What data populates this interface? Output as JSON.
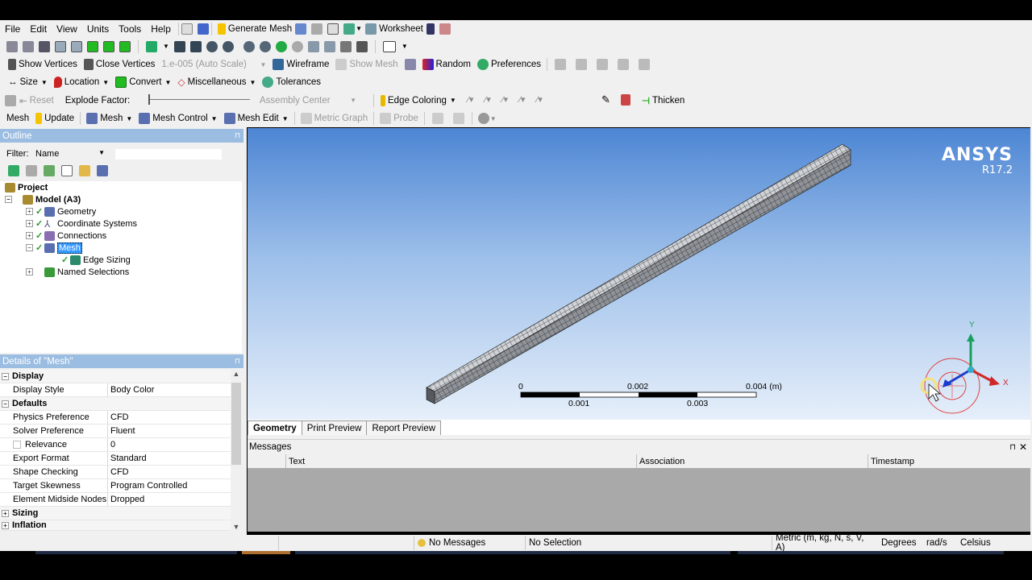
{
  "menu": [
    "File",
    "Edit",
    "View",
    "Units",
    "Tools",
    "Help"
  ],
  "menubar_tools": {
    "generate_mesh": "Generate Mesh",
    "worksheet": "Worksheet"
  },
  "row3": {
    "show_vertices": "Show Vertices",
    "close_vertices": "Close Vertices",
    "scale": "1.e-005 (Auto Scale)",
    "wireframe": "Wireframe",
    "show_mesh": "Show Mesh",
    "random": "Random",
    "preferences": "Preferences"
  },
  "row4": {
    "size": "Size",
    "location": "Location",
    "convert": "Convert",
    "miscellaneous": "Miscellaneous",
    "tolerances": "Tolerances"
  },
  "row5": {
    "reset": "Reset",
    "explode_factor": "Explode Factor:",
    "assembly_center": "Assembly Center",
    "edge_coloring": "Edge Coloring",
    "thicken": "Thicken"
  },
  "row6": {
    "mesh_label": "Mesh",
    "update": "Update",
    "mesh": "Mesh",
    "mesh_control": "Mesh Control",
    "mesh_edit": "Mesh Edit",
    "metric_graph": "Metric Graph",
    "probe": "Probe"
  },
  "outline": {
    "title": "Outline",
    "filter_label": "Filter:",
    "filter_value": "Name",
    "tree": {
      "project": "Project",
      "model": "Model (A3)",
      "geometry": "Geometry",
      "coordinate_systems": "Coordinate Systems",
      "connections": "Connections",
      "mesh": "Mesh",
      "edge_sizing": "Edge Sizing",
      "named_selections": "Named Selections"
    }
  },
  "details": {
    "title": "Details of \"Mesh\"",
    "sections": {
      "display": "Display",
      "defaults": "Defaults",
      "sizing": "Sizing",
      "inflation": "Inflation"
    },
    "rows": [
      {
        "k": "Display Style",
        "v": "Body Color"
      },
      {
        "k": "Physics Preference",
        "v": "CFD"
      },
      {
        "k": "Solver Preference",
        "v": "Fluent"
      },
      {
        "k": "Relevance",
        "v": "0"
      },
      {
        "k": "Export Format",
        "v": "Standard"
      },
      {
        "k": "Shape Checking",
        "v": "CFD"
      },
      {
        "k": "Target Skewness",
        "v": "Program Controlled"
      },
      {
        "k": "Element Midside Nodes",
        "v": "Dropped"
      }
    ]
  },
  "viewport": {
    "brand": "ANSYS",
    "version": "R17.2",
    "scale_top": [
      "0",
      "0.002",
      "0.004 (m)"
    ],
    "scale_bottom": [
      "0.001",
      "0.003"
    ],
    "axis_x": "X",
    "axis_y": "Y"
  },
  "tabs": [
    "Geometry",
    "Print Preview",
    "Report Preview"
  ],
  "messages": {
    "title": "Messages",
    "columns": [
      "Text",
      "Association",
      "Timestamp"
    ]
  },
  "status": {
    "no_messages": "No Messages",
    "no_selection": "No Selection",
    "units": "Metric (m, kg, N, s, V, A)",
    "degrees": "Degrees",
    "rads": "rad/s",
    "celsius": "Celsius"
  },
  "colors": {
    "panel_title": "#9bbde2",
    "viewport_top": "#4d86d4",
    "viewport_bottom": "#e6effa",
    "selection": "#3399ff"
  }
}
